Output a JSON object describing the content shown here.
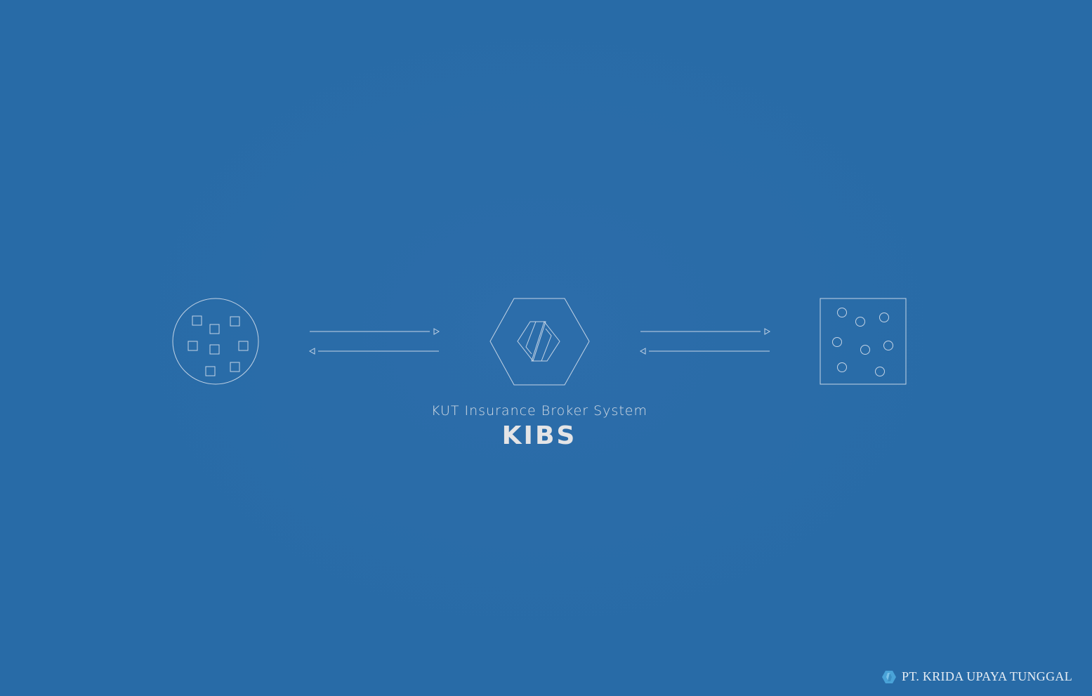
{
  "splash": {
    "subtitle": "KUT Insurance Broker System",
    "title": "KIBS"
  },
  "footer": {
    "company_name": "PT. KRIDA UPAYA TUNGGAL"
  },
  "icons": {
    "left_node": "circle-with-squares-icon",
    "center_node": "hexagon-logo-icon",
    "right_node": "square-with-circles-icon",
    "arrows": "bidirectional-arrow-icon",
    "company_logo": "hexagon-logo-icon"
  },
  "colors": {
    "background": "#2a6ca8",
    "line": "#c4d4e6",
    "title_text": "#e4e4e6",
    "company_logo": "#4aa3d8"
  }
}
